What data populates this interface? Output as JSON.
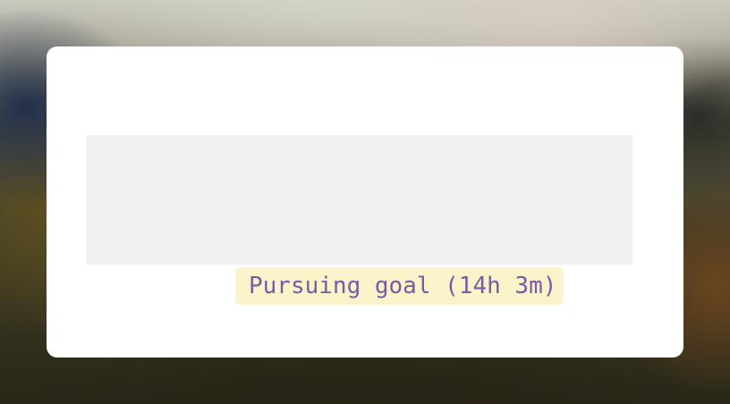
{
  "status": {
    "text": "Pursuing goal (14h 3m)",
    "text_color": "#7b5aa3",
    "background_color": "#fbf3c9"
  }
}
